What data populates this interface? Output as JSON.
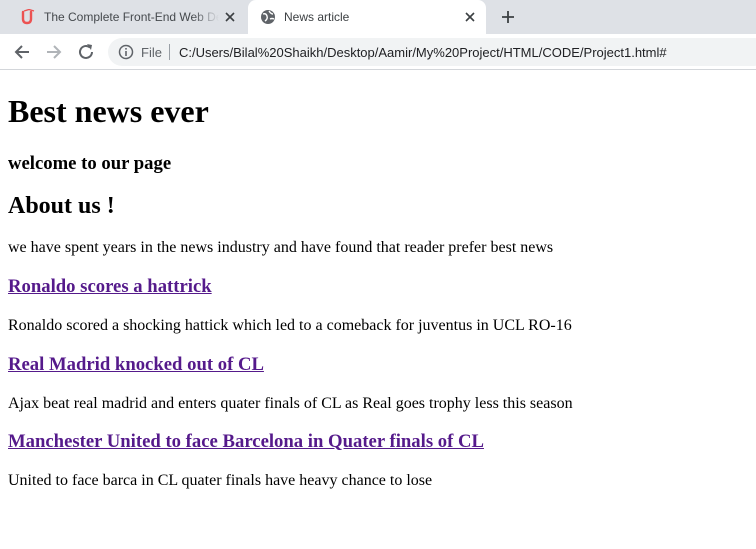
{
  "browser": {
    "tabs": [
      {
        "title": "The Complete Front-End Web Development Course",
        "active": false
      },
      {
        "title": "News article",
        "active": true
      }
    ],
    "address": {
      "scheme_label": "File",
      "url": "C:/Users/Bilal%20Shaikh/Desktop/Aamir/My%20Project/HTML/CODE/Project1.html#"
    }
  },
  "page": {
    "title": "Best news ever",
    "welcome": "welcome to our page",
    "about_heading": "About us !",
    "about_text": "we have spent years in the news industry and have found that reader prefer best news",
    "articles": [
      {
        "headline": "Ronaldo scores a hattrick",
        "summary": "Ronaldo scored a shocking hattick which led to a comeback for juventus in UCL RO-16"
      },
      {
        "headline": "Real Madrid knocked out of CL",
        "summary": "Ajax beat real madrid and enters quater finals of CL as Real goes trophy less this season"
      },
      {
        "headline": "Manchester United to face Barcelona in Quater finals of CL",
        "summary": "United to face barca in CL quater finals have heavy chance to lose"
      }
    ]
  },
  "colors": {
    "visited_link": "#551a8b",
    "tabstrip_bg": "#dee1e6",
    "udemy_brand": "#ec5252"
  }
}
